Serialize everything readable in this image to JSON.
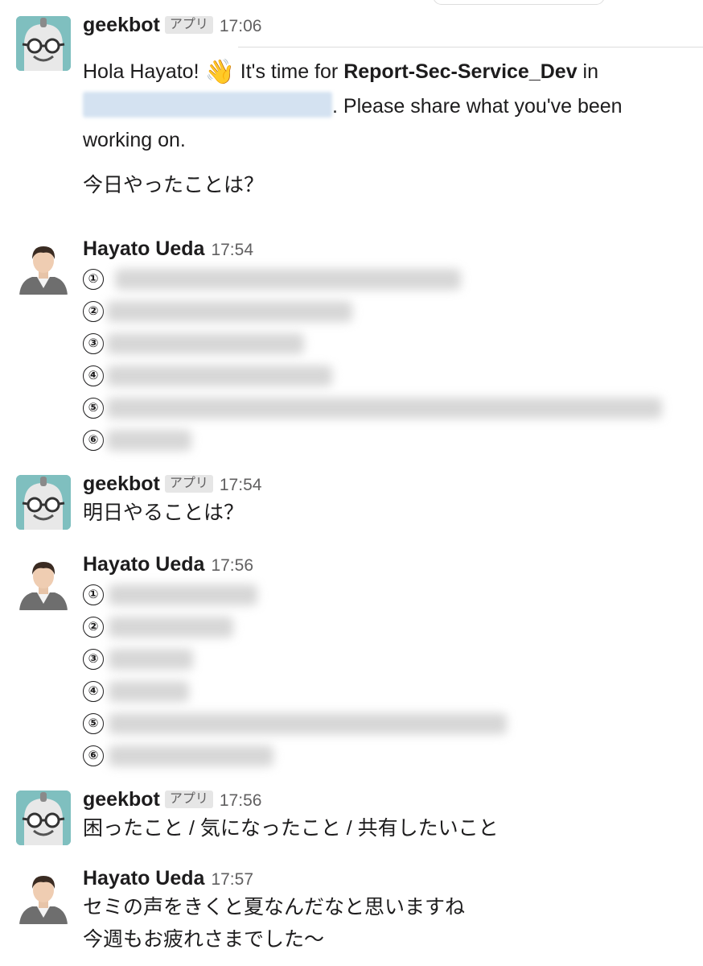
{
  "messages": [
    {
      "author": "geekbot",
      "badge": "アプリ",
      "time": "17:06",
      "greeting_start": "Hola Hayato! ",
      "wave_emoji": "👋",
      "greeting_mid": " It's time for ",
      "report_name": "Report-Sec-Service_Dev",
      "greeting_end": " in",
      "after_channel": ". Please share what you've been working on.",
      "question": "今日やったことは？"
    },
    {
      "author": "Hayato Ueda",
      "time": "17:54",
      "list_numbers": [
        "①",
        "②",
        "③",
        "④",
        "⑤",
        "⑥"
      ]
    },
    {
      "author": "geekbot",
      "badge": "アプリ",
      "time": "17:54",
      "question": "明日やることは？"
    },
    {
      "author": "Hayato Ueda",
      "time": "17:56",
      "list_numbers": [
        "①",
        "②",
        "③",
        "④",
        "⑤",
        "⑥"
      ]
    },
    {
      "author": "geekbot",
      "badge": "アプリ",
      "time": "17:56",
      "question": "困ったこと / 気になったこと / 共有したいこと"
    },
    {
      "author": "Hayato Ueda",
      "time": "17:57",
      "lines": [
        "セミの声をきくと夏なんだなと思いますね",
        "今週もお疲れさまでした〜"
      ]
    }
  ],
  "colors": {
    "bot_avatar_bg": "#7fbfbf",
    "text": "#1d1c1d",
    "muted": "#616061",
    "redacted_channel": "#d4e2f1"
  },
  "icons": {
    "bot_avatar": "robot-glasses-icon",
    "user_avatar": "person-photo-icon"
  }
}
